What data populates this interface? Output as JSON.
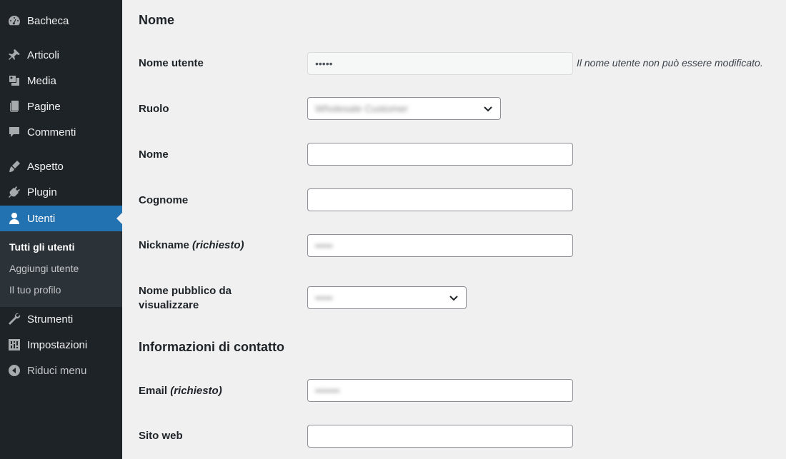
{
  "sidebar": {
    "items": [
      {
        "label": "Bacheca",
        "icon": "dashboard-icon"
      },
      {
        "label": "Articoli",
        "icon": "pin-icon"
      },
      {
        "label": "Media",
        "icon": "media-icon"
      },
      {
        "label": "Pagine",
        "icon": "page-icon"
      },
      {
        "label": "Commenti",
        "icon": "comment-icon"
      },
      {
        "label": "Aspetto",
        "icon": "brush-icon"
      },
      {
        "label": "Plugin",
        "icon": "plugin-icon"
      },
      {
        "label": "Utenti",
        "icon": "user-icon"
      },
      {
        "label": "Strumenti",
        "icon": "wrench-icon"
      },
      {
        "label": "Impostazioni",
        "icon": "settings-icon"
      },
      {
        "label": "Riduci menu",
        "icon": "collapse-icon"
      }
    ],
    "submenu": [
      "Tutti gli utenti",
      "Aggiungi utente",
      "Il tuo profilo"
    ],
    "active_color": "#2271b1",
    "bg_color": "#1d2327"
  },
  "form": {
    "section_name": "Nome",
    "section_contact": "Informazioni di contatto",
    "username_label": "Nome utente",
    "username_value": "•••••",
    "username_desc": "Il nome utente non può essere modificato.",
    "role_label": "Ruolo",
    "role_value": "Wholesale Customer",
    "firstname_label": "Nome",
    "firstname_value": "",
    "lastname_label": "Cognome",
    "lastname_value": "",
    "nickname_label": "Nickname",
    "required_text": "(richiesto)",
    "nickname_value": "•••••",
    "display_label_line1": "Nome pubblico da",
    "display_label_line2": "visualizzare",
    "display_value": "•••••",
    "email_label": "Email",
    "email_value": "•••••••",
    "website_label": "Sito web",
    "website_value": ""
  }
}
